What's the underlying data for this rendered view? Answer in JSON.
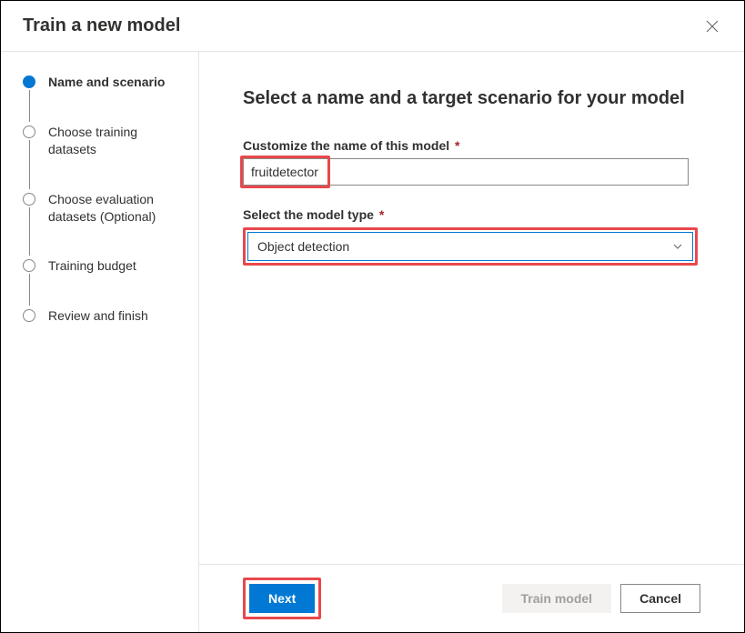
{
  "header": {
    "title": "Train a new model"
  },
  "sidebar": {
    "steps": [
      {
        "label": "Name and scenario",
        "active": true
      },
      {
        "label": "Choose training datasets",
        "active": false
      },
      {
        "label": "Choose evaluation datasets (Optional)",
        "active": false
      },
      {
        "label": "Training budget",
        "active": false
      },
      {
        "label": "Review and finish",
        "active": false
      }
    ]
  },
  "main": {
    "heading": "Select a name and a target scenario for your model",
    "name_field": {
      "label": "Customize the name of this model",
      "value": "fruitdetector"
    },
    "type_field": {
      "label": "Select the model type",
      "value": "Object detection"
    }
  },
  "footer": {
    "next": "Next",
    "train_model": "Train model",
    "cancel": "Cancel"
  },
  "colors": {
    "primary": "#0078d4",
    "highlight": "#e8484c",
    "required": "#a4262c"
  }
}
